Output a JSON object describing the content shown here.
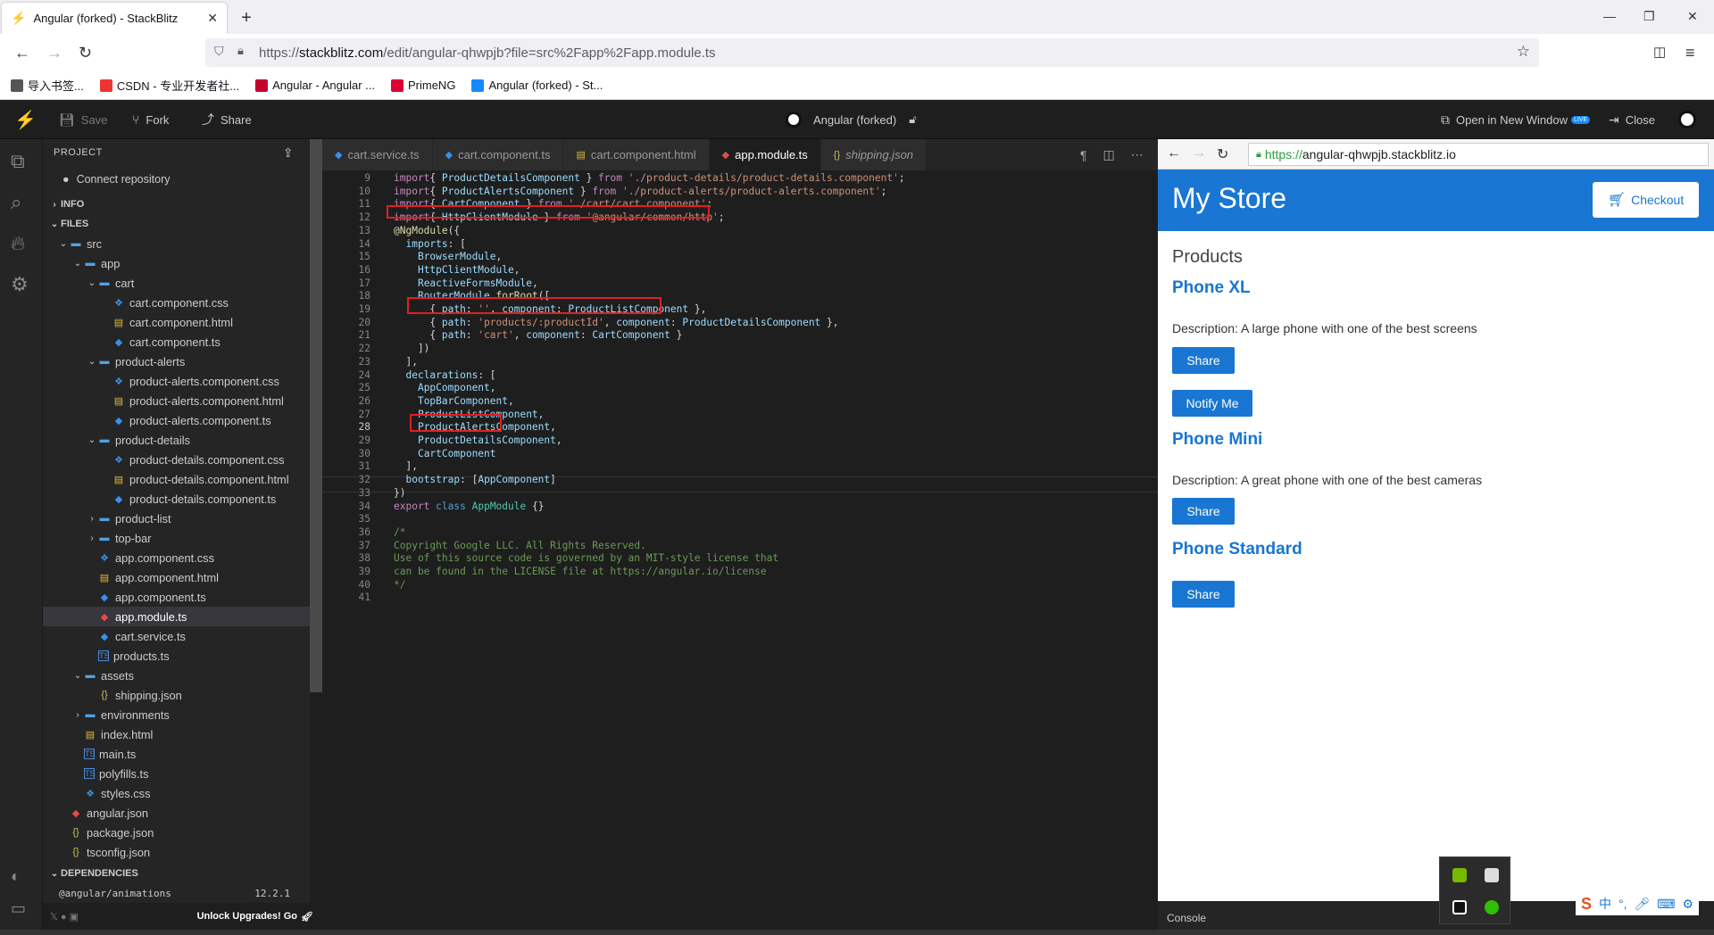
{
  "browser": {
    "tab_title": "Angular (forked) - StackBlitz",
    "url_prefix": "https://",
    "url_domain": "stackblitz.com",
    "url_path": "/edit/angular-qhwpjb?file=src%2Fapp%2Fapp.module.ts",
    "bookmarks": [
      "导入书签...",
      "CSDN - 专业开发者社...",
      "Angular - Angular ...",
      "PrimeNG",
      "Angular (forked) - St..."
    ]
  },
  "header": {
    "save": "Save",
    "fork": "Fork",
    "share": "Share",
    "project_title": "Angular (forked)",
    "open_new_window": "Open in New Window",
    "live_badge": "LIVE",
    "close": "Close"
  },
  "sidebar": {
    "project_label": "PROJECT",
    "connect_repo": "Connect repository",
    "info_label": "INFO",
    "files_label": "FILES",
    "tree": [
      {
        "name": "src",
        "type": "folder",
        "depth": 0,
        "open": true
      },
      {
        "name": "app",
        "type": "folder",
        "depth": 1,
        "open": true
      },
      {
        "name": "cart",
        "type": "folder",
        "depth": 2,
        "open": true
      },
      {
        "name": "cart.component.css",
        "type": "css",
        "depth": 3
      },
      {
        "name": "cart.component.html",
        "type": "html",
        "depth": 3
      },
      {
        "name": "cart.component.ts",
        "type": "ng",
        "depth": 3
      },
      {
        "name": "product-alerts",
        "type": "folder",
        "depth": 2,
        "open": true
      },
      {
        "name": "product-alerts.component.css",
        "type": "css",
        "depth": 3
      },
      {
        "name": "product-alerts.component.html",
        "type": "html",
        "depth": 3
      },
      {
        "name": "product-alerts.component.ts",
        "type": "ng",
        "depth": 3
      },
      {
        "name": "product-details",
        "type": "folder",
        "depth": 2,
        "open": true
      },
      {
        "name": "product-details.component.css",
        "type": "css",
        "depth": 3
      },
      {
        "name": "product-details.component.html",
        "type": "html",
        "depth": 3
      },
      {
        "name": "product-details.component.ts",
        "type": "ng",
        "depth": 3
      },
      {
        "name": "product-list",
        "type": "folder",
        "depth": 2,
        "open": false
      },
      {
        "name": "top-bar",
        "type": "folder",
        "depth": 2,
        "open": false
      },
      {
        "name": "app.component.css",
        "type": "css",
        "depth": 2
      },
      {
        "name": "app.component.html",
        "type": "html",
        "depth": 2
      },
      {
        "name": "app.component.ts",
        "type": "ng",
        "depth": 2
      },
      {
        "name": "app.module.ts",
        "type": "ngr",
        "depth": 2,
        "selected": true
      },
      {
        "name": "cart.service.ts",
        "type": "ng",
        "depth": 2
      },
      {
        "name": "products.ts",
        "type": "ts",
        "depth": 2
      },
      {
        "name": "assets",
        "type": "folder",
        "depth": 1,
        "open": true
      },
      {
        "name": "shipping.json",
        "type": "json",
        "depth": 2
      },
      {
        "name": "environments",
        "type": "folder",
        "depth": 1,
        "open": false
      },
      {
        "name": "index.html",
        "type": "html",
        "depth": 1
      },
      {
        "name": "main.ts",
        "type": "ts",
        "depth": 1
      },
      {
        "name": "polyfills.ts",
        "type": "ts",
        "depth": 1
      },
      {
        "name": "styles.css",
        "type": "css",
        "depth": 1
      },
      {
        "name": "angular.json",
        "type": "ngr",
        "depth": 0
      },
      {
        "name": "package.json",
        "type": "json",
        "depth": 0
      },
      {
        "name": "tsconfig.json",
        "type": "json",
        "depth": 0
      }
    ],
    "dependencies_label": "DEPENDENCIES",
    "dep_name": "@angular/animations",
    "dep_version": "12.2.1",
    "unlock": "Unlock Upgrades! Go"
  },
  "editor": {
    "tabs": [
      {
        "label": "cart.service.ts",
        "icon": "ng",
        "active": false,
        "italic": false
      },
      {
        "label": "cart.component.ts",
        "icon": "ng",
        "active": false,
        "italic": false
      },
      {
        "label": "cart.component.html",
        "icon": "html",
        "active": false,
        "italic": false
      },
      {
        "label": "app.module.ts",
        "icon": "ngr",
        "active": true,
        "italic": false
      },
      {
        "label": "shipping.json",
        "icon": "json",
        "active": false,
        "italic": true
      }
    ],
    "lines": [
      {
        "n": "9",
        "t": [
          [
            "kw",
            "import"
          ],
          [
            "",
            "{ "
          ],
          [
            "vr",
            "ProductDetailsComponent"
          ],
          [
            "",
            " } "
          ],
          [
            "kw",
            "from"
          ],
          [
            "",
            " "
          ],
          [
            "str",
            "'./product-details/product-details.component'"
          ],
          [
            "",
            ";"
          ]
        ]
      },
      {
        "n": "10",
        "t": [
          [
            "kw",
            "import"
          ],
          [
            "",
            "{ "
          ],
          [
            "vr",
            "ProductAlertsComponent"
          ],
          [
            "",
            " } "
          ],
          [
            "kw",
            "from"
          ],
          [
            "",
            " "
          ],
          [
            "str",
            "'./product-alerts/product-alerts.component'"
          ],
          [
            "",
            ";"
          ]
        ]
      },
      {
        "n": "11",
        "t": [
          [
            "kw",
            "import"
          ],
          [
            "",
            "{ "
          ],
          [
            "vr",
            "CartComponent"
          ],
          [
            "",
            " } "
          ],
          [
            "kw",
            "from"
          ],
          [
            "",
            " "
          ],
          [
            "str",
            "'./cart/cart.component'"
          ],
          [
            "",
            ";"
          ]
        ]
      },
      {
        "n": "12",
        "t": [
          [
            "kw",
            "import"
          ],
          [
            "",
            "{ "
          ],
          [
            "vr",
            "HttpClientModule"
          ],
          [
            "",
            " } "
          ],
          [
            "kw",
            "from"
          ],
          [
            "",
            " "
          ],
          [
            "str",
            "'@angular/common/http'"
          ],
          [
            "",
            ";"
          ]
        ]
      },
      {
        "n": "13",
        "t": [
          [
            "fn",
            "@NgModule"
          ],
          [
            "",
            "({"
          ]
        ]
      },
      {
        "n": "14",
        "t": [
          [
            "",
            "  "
          ],
          [
            "vr",
            "imports"
          ],
          [
            "",
            ": ["
          ]
        ]
      },
      {
        "n": "15",
        "t": [
          [
            "",
            "    "
          ],
          [
            "vr",
            "BrowserModule"
          ],
          [
            "",
            ","
          ]
        ]
      },
      {
        "n": "16",
        "t": [
          [
            "",
            "    "
          ],
          [
            "vr",
            "HttpClientModule"
          ],
          [
            "",
            ","
          ]
        ]
      },
      {
        "n": "17",
        "t": [
          [
            "",
            "    "
          ],
          [
            "vr",
            "ReactiveFormsModule"
          ],
          [
            "",
            ","
          ]
        ]
      },
      {
        "n": "18",
        "t": [
          [
            "",
            "    "
          ],
          [
            "vr",
            "RouterModule"
          ],
          [
            "",
            "."
          ],
          [
            "fn",
            "forRoot"
          ],
          [
            "",
            "(["
          ]
        ]
      },
      {
        "n": "19",
        "t": [
          [
            "",
            "      { "
          ],
          [
            "vr",
            "path"
          ],
          [
            "",
            ": "
          ],
          [
            "str",
            "''"
          ],
          [
            "",
            ", "
          ],
          [
            "vr",
            "component"
          ],
          [
            "",
            ": "
          ],
          [
            "vr",
            "ProductListComponent"
          ],
          [
            "",
            " },"
          ]
        ]
      },
      {
        "n": "20",
        "t": [
          [
            "",
            "      { "
          ],
          [
            "vr",
            "path"
          ],
          [
            "",
            ": "
          ],
          [
            "str",
            "'products/:productId'"
          ],
          [
            "",
            ", "
          ],
          [
            "vr",
            "component"
          ],
          [
            "",
            ": "
          ],
          [
            "vr",
            "ProductDetailsComponent"
          ],
          [
            "",
            " },"
          ]
        ]
      },
      {
        "n": "21",
        "t": [
          [
            "",
            "      { "
          ],
          [
            "vr",
            "path"
          ],
          [
            "",
            ": "
          ],
          [
            "str",
            "'cart'"
          ],
          [
            "",
            ", "
          ],
          [
            "vr",
            "component"
          ],
          [
            "",
            ": "
          ],
          [
            "vr",
            "CartComponent"
          ],
          [
            "",
            " }"
          ]
        ]
      },
      {
        "n": "22",
        "t": [
          [
            "",
            "    ])"
          ]
        ]
      },
      {
        "n": "23",
        "t": [
          [
            "",
            "  ],"
          ]
        ]
      },
      {
        "n": "24",
        "t": [
          [
            "",
            "  "
          ],
          [
            "vr",
            "declarations"
          ],
          [
            "",
            ": ["
          ]
        ]
      },
      {
        "n": "25",
        "t": [
          [
            "",
            "    "
          ],
          [
            "vr",
            "AppComponent"
          ],
          [
            "",
            ","
          ]
        ]
      },
      {
        "n": "26",
        "t": [
          [
            "",
            "    "
          ],
          [
            "vr",
            "TopBarComponent"
          ],
          [
            "",
            ","
          ]
        ]
      },
      {
        "n": "27",
        "t": [
          [
            "",
            "    "
          ],
          [
            "vr",
            "ProductListComponent"
          ],
          [
            "",
            ","
          ]
        ]
      },
      {
        "n": "28",
        "t": [
          [
            "",
            "    "
          ],
          [
            "vr",
            "ProductAlertsComponent"
          ],
          [
            "",
            ","
          ]
        ]
      },
      {
        "n": "29",
        "t": [
          [
            "",
            "    "
          ],
          [
            "vr",
            "ProductDetailsComponent"
          ],
          [
            "",
            ","
          ]
        ]
      },
      {
        "n": "30",
        "t": [
          [
            "",
            "    "
          ],
          [
            "vr",
            "CartComponent"
          ]
        ]
      },
      {
        "n": "31",
        "t": [
          [
            "",
            "  ],"
          ]
        ]
      },
      {
        "n": "32",
        "t": [
          [
            "",
            "  "
          ],
          [
            "vr",
            "bootstrap"
          ],
          [
            "",
            ": ["
          ],
          [
            "vr",
            "AppComponent"
          ],
          [
            "",
            "]"
          ]
        ]
      },
      {
        "n": "33",
        "t": [
          [
            "",
            "})"
          ]
        ]
      },
      {
        "n": "34",
        "t": [
          [
            "kw",
            "export"
          ],
          [
            "",
            " "
          ],
          [
            "kb",
            "class"
          ],
          [
            "",
            " "
          ],
          [
            "ty",
            "AppModule"
          ],
          [
            "",
            " {}"
          ]
        ]
      },
      {
        "n": "35",
        "t": [
          [
            "",
            ""
          ]
        ]
      },
      {
        "n": "36",
        "t": [
          [
            "cm",
            "/*"
          ]
        ]
      },
      {
        "n": "37",
        "t": [
          [
            "cm",
            "Copyright Google LLC. All Rights Reserved."
          ]
        ]
      },
      {
        "n": "38",
        "t": [
          [
            "cm",
            "Use of this source code is governed by an MIT-style license that"
          ]
        ]
      },
      {
        "n": "39",
        "t": [
          [
            "cm",
            "can be found in the LICENSE file at https://angular.io/license"
          ]
        ]
      },
      {
        "n": "40",
        "t": [
          [
            "cm",
            "*/"
          ]
        ]
      },
      {
        "n": "41",
        "t": [
          [
            "",
            ""
          ]
        ]
      }
    ]
  },
  "preview": {
    "url_https": "https://",
    "url_host": "angular-qhwpjb.stackblitz.io",
    "store_title": "My Store",
    "checkout": "Checkout",
    "products_heading": "Products",
    "products": [
      {
        "name": "Phone XL",
        "description": "Description: A large phone with one of the best screens",
        "share": "Share",
        "notify": "Notify Me"
      },
      {
        "name": "Phone Mini",
        "description": "Description: A great phone with one of the best cameras",
        "share": "Share"
      },
      {
        "name": "Phone Standard",
        "share": "Share"
      }
    ],
    "console": "Console"
  },
  "tray": {
    "ime_label": "中"
  },
  "colors": {
    "accent": "#1976d2",
    "highlight": "#e02020",
    "editor_bg": "#1e1e1e",
    "sidebar_bg": "#252526"
  }
}
